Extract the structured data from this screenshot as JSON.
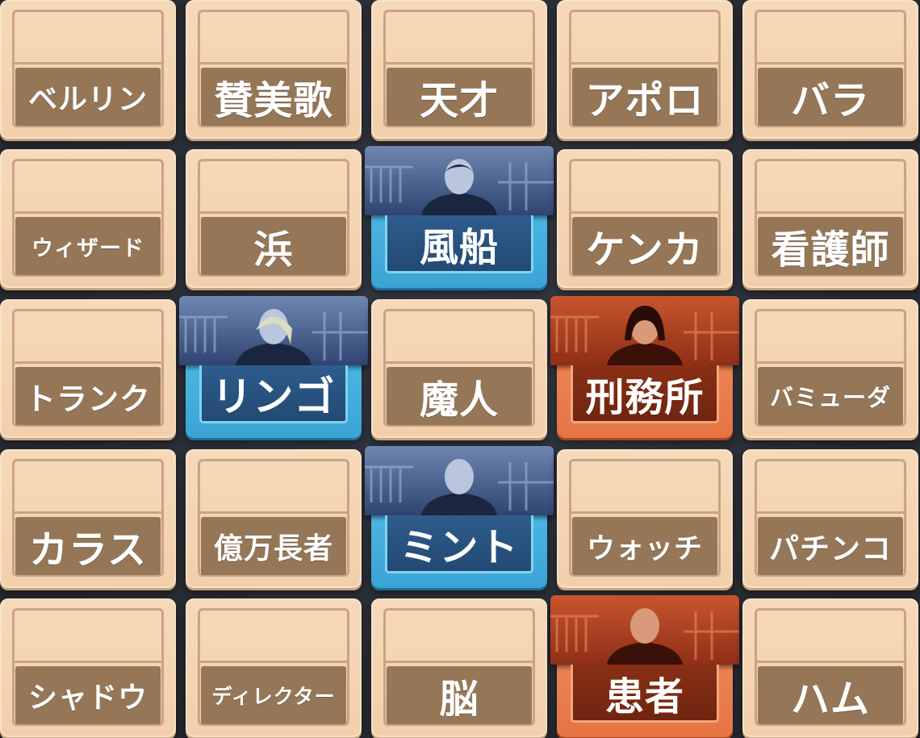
{
  "board": {
    "cards": [
      {
        "word": "ベルリン",
        "type": "neutral",
        "size": 36
      },
      {
        "word": "賛美歌",
        "type": "neutral",
        "size": 48
      },
      {
        "word": "天才",
        "type": "neutral",
        "size": 48
      },
      {
        "word": "アポロ",
        "type": "neutral",
        "size": 48
      },
      {
        "word": "バラ",
        "type": "neutral",
        "size": 48
      },
      {
        "word": "ウィザード",
        "type": "neutral",
        "size": 27
      },
      {
        "word": "浜",
        "type": "neutral",
        "size": 48
      },
      {
        "word": "風船",
        "type": "blue",
        "size": 48,
        "portrait": "blue-agent-man-suit"
      },
      {
        "word": "ケンカ",
        "type": "neutral",
        "size": 48
      },
      {
        "word": "看護師",
        "type": "neutral",
        "size": 48
      },
      {
        "word": "トランク",
        "type": "neutral",
        "size": 38
      },
      {
        "word": "リンゴ",
        "type": "blue",
        "size": 50,
        "portrait": "blue-agent-woman-blonde"
      },
      {
        "word": "魔人",
        "type": "neutral",
        "size": 48
      },
      {
        "word": "刑務所",
        "type": "red",
        "size": 48,
        "portrait": "red-agent-woman-bob"
      },
      {
        "word": "バミューダ",
        "type": "neutral",
        "size": 29
      },
      {
        "word": "カラス",
        "type": "neutral",
        "size": 48
      },
      {
        "word": "億万長者",
        "type": "neutral",
        "size": 36
      },
      {
        "word": "ミント",
        "type": "blue",
        "size": 48,
        "portrait": "blue-agent-bald-man"
      },
      {
        "word": "ウォッチ",
        "type": "neutral",
        "size": 35
      },
      {
        "word": "パチンコ",
        "type": "neutral",
        "size": 37
      },
      {
        "word": "シャドウ",
        "type": "neutral",
        "size": 36
      },
      {
        "word": "ディレクター",
        "type": "neutral",
        "size": 25
      },
      {
        "word": "脳",
        "type": "neutral",
        "size": 48
      },
      {
        "word": "患者",
        "type": "red",
        "size": 48,
        "portrait": "red-agent-bald-man"
      },
      {
        "word": "ハム",
        "type": "neutral",
        "size": 48
      }
    ]
  },
  "colors": {
    "neutral": "#f2cfab",
    "blue_team": "#3aa3d4",
    "red_team": "#e67445",
    "background": "#2b2f36"
  }
}
